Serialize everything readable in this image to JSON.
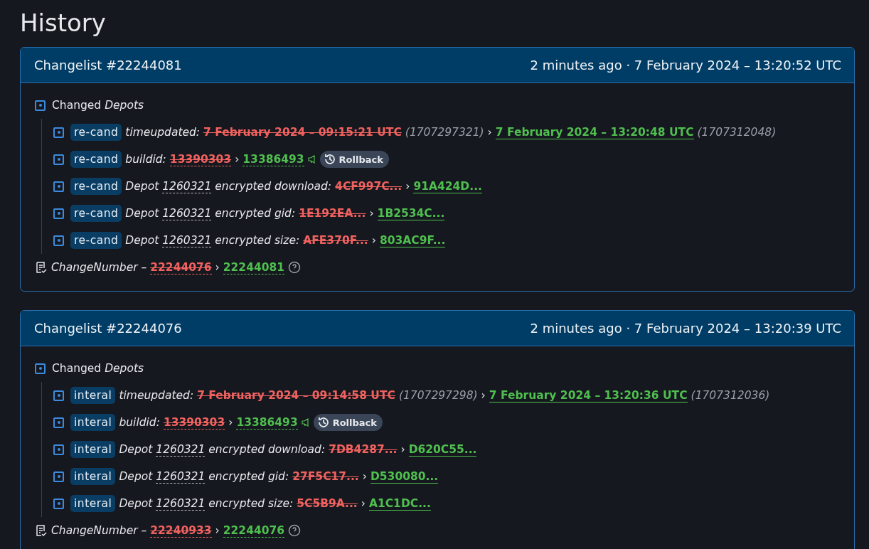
{
  "page_title": "History",
  "changelists": [
    {
      "title": "Changelist #22244081",
      "time": "2 minutes ago · 7 February 2024 – 13:20:52 UTC",
      "group": {
        "label": "Changed",
        "label_em": "Depots"
      },
      "rows": [
        {
          "kind": "time",
          "tag": "re-cand",
          "key": "timeupdated:",
          "old": "7 February 2024 – 09:15:21 UTC",
          "old_raw": "(1707297321)",
          "sep": "›",
          "new": "7 February 2024 – 13:20:48 UTC",
          "new_raw": "(1707312048)"
        },
        {
          "kind": "build",
          "tag": "re-cand",
          "key": "buildid:",
          "old": "13390303",
          "sep": "›",
          "new": "13386493",
          "button": "Rollback"
        },
        {
          "kind": "depot",
          "tag": "re-cand",
          "prefix": "Depot",
          "depot_id": "1260321",
          "key": "encrypted download:",
          "old": "4CF997C...",
          "sep": "›",
          "new": "91A424D..."
        },
        {
          "kind": "depot",
          "tag": "re-cand",
          "prefix": "Depot",
          "depot_id": "1260321",
          "key": "encrypted gid:",
          "old": "1E192EA...",
          "sep": "›",
          "new": "1B2534C..."
        },
        {
          "kind": "depot",
          "tag": "re-cand",
          "prefix": "Depot",
          "depot_id": "1260321",
          "key": "encrypted size:",
          "old": "AFE370F...",
          "sep": "›",
          "new": "803AC9F..."
        }
      ],
      "change": {
        "label": "ChangeNumber –",
        "old": "22244076",
        "sep": "›",
        "new": "22244081"
      }
    },
    {
      "title": "Changelist #22244076",
      "time": "2 minutes ago · 7 February 2024 – 13:20:39 UTC",
      "group": {
        "label": "Changed",
        "label_em": "Depots"
      },
      "rows": [
        {
          "kind": "time",
          "tag": "interal",
          "key": "timeupdated:",
          "old": "7 February 2024 – 09:14:58 UTC",
          "old_raw": "(1707297298)",
          "sep": "›",
          "new": "7 February 2024 – 13:20:36 UTC",
          "new_raw": "(1707312036)"
        },
        {
          "kind": "build",
          "tag": "interal",
          "key": "buildid:",
          "old": "13390303",
          "sep": "›",
          "new": "13386493",
          "button": "Rollback"
        },
        {
          "kind": "depot",
          "tag": "interal",
          "prefix": "Depot",
          "depot_id": "1260321",
          "key": "encrypted download:",
          "old": "7DB4287...",
          "sep": "›",
          "new": "D620C55..."
        },
        {
          "kind": "depot",
          "tag": "interal",
          "prefix": "Depot",
          "depot_id": "1260321",
          "key": "encrypted gid:",
          "old": "27F5C17...",
          "sep": "›",
          "new": "D530080..."
        },
        {
          "kind": "depot",
          "tag": "interal",
          "prefix": "Depot",
          "depot_id": "1260321",
          "key": "encrypted size:",
          "old": "5C5B9A...",
          "sep": "›",
          "new": "A1C1DC..."
        }
      ],
      "change": {
        "label": "ChangeNumber –",
        "old": "22240933",
        "sep": "›",
        "new": "22244076"
      }
    }
  ]
}
